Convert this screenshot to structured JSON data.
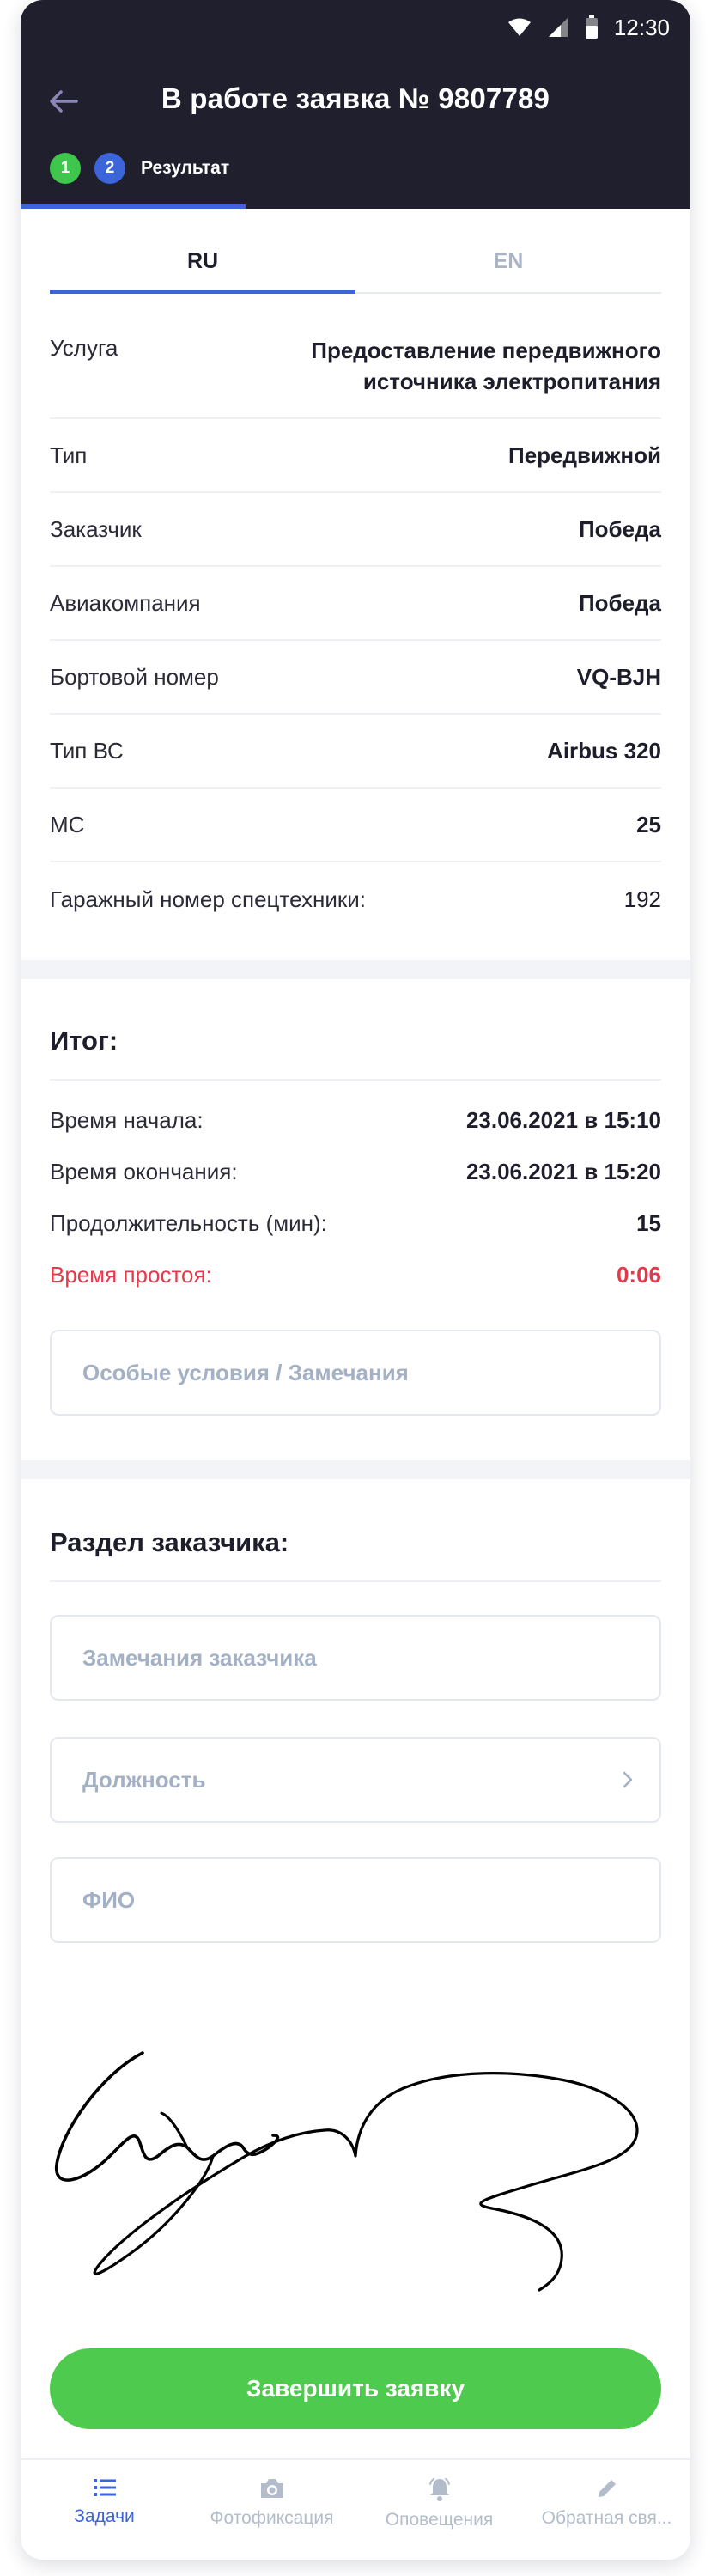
{
  "status_bar": {
    "time": "12:30"
  },
  "header": {
    "title": "В работе заявка № 9807789",
    "steps": [
      {
        "number": "1",
        "color": "#3fc74d"
      },
      {
        "number": "2",
        "color": "#3b65d9",
        "label": "Результат"
      }
    ]
  },
  "lang_tabs": {
    "active": "RU",
    "inactive": "EN"
  },
  "info_rows": [
    {
      "key": "Услуга",
      "value": "Предоставление передвижного источника электропитания"
    },
    {
      "key": "Тип",
      "value": "Передвижной"
    },
    {
      "key": "Заказчик",
      "value": "Победа"
    },
    {
      "key": "Авиакомпания",
      "value": "Победа"
    },
    {
      "key": "Бортовой номер",
      "value": "VQ-BJH"
    },
    {
      "key": "Тип ВС",
      "value": "Airbus 320"
    },
    {
      "key": "МС",
      "value": "25"
    },
    {
      "key": "Гаражный номер спецтехники:",
      "value": "192"
    }
  ],
  "summary": {
    "title": "Итог:",
    "rows": [
      {
        "key": "Время начала:",
        "value": "23.06.2021 в 15:10"
      },
      {
        "key": "Время окончания:",
        "value": "23.06.2021 в 15:20"
      },
      {
        "key": "Продолжительность (мин):",
        "value": "15"
      },
      {
        "key": "Время простоя:",
        "value": "0:06"
      }
    ],
    "alert_color": "#e23a4a",
    "remarks_placeholder": "Особые условия / Замечания"
  },
  "customer_section": {
    "title": "Раздел заказчика:",
    "remarks_placeholder": "Замечания заказчика",
    "position_placeholder": "Должность",
    "name_placeholder": "ФИО"
  },
  "finish_button": {
    "label": "Завершить заявку",
    "color": "#4ecb4f"
  },
  "bottom_nav": [
    {
      "label": "Задачи",
      "icon": "list-icon",
      "active": true
    },
    {
      "label": "Фотофиксация",
      "icon": "camera-icon",
      "active": false
    },
    {
      "label": "Оповещения",
      "icon": "bell-icon",
      "active": false
    },
    {
      "label": "Обратная свя...",
      "icon": "pencil-icon",
      "active": false
    }
  ],
  "colors": {
    "header_bg": "#1f1f2d",
    "accent": "#3b65d9"
  }
}
